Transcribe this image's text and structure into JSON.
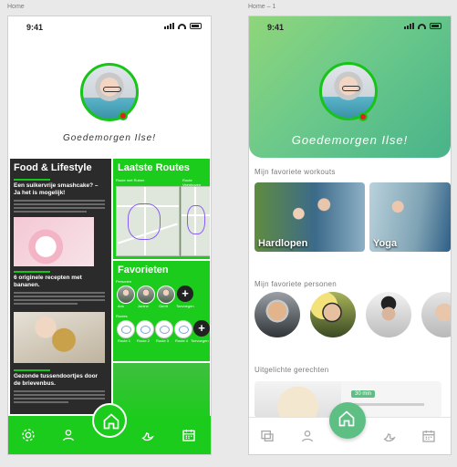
{
  "frames": {
    "left_label": "Home",
    "right_label": "Home – 1"
  },
  "status": {
    "time": "9:41"
  },
  "phone_a": {
    "greeting": "Goedemorgen Ilse!",
    "food": {
      "title": "Food & Lifestyle",
      "article1": "Een suikervrije smashcake? – Ja het is mogelijk!",
      "article2": "6 originele recepten met bananen.",
      "article3": "Gezonde tussendoortjes door de brievenbus."
    },
    "routes": {
      "title": "Laatste Routes",
      "map1_label": "Route met Ruben",
      "map2_label": "Route Veenhoven"
    },
    "favorites": {
      "title": "Favorieten",
      "persons_label": "Personen",
      "routes_label": "Routes",
      "person_names": [
        "Ans",
        "Janine",
        "Gerrit",
        "Toevoegen"
      ],
      "route_names": [
        "Route 1",
        "Route 2",
        "Route 3",
        "Route 4",
        "Toevoegen"
      ]
    },
    "nav": [
      "settings-icon",
      "profile-icon",
      "home-icon",
      "strength-icon",
      "calendar-icon"
    ]
  },
  "phone_b": {
    "greeting": "Goedemorgen Ilse!",
    "workouts_title": "Mijn favoriete workouts",
    "workouts": [
      "Hardlopen",
      "Yoga"
    ],
    "persons_title": "Mijn favoriete personen",
    "dishes_title": "Uitgelichte gerechten",
    "dish_badge": "30 min",
    "nav": [
      "photo-icon",
      "profile-icon",
      "home-icon",
      "strength-icon",
      "calendar-icon"
    ]
  },
  "colors": {
    "accent_green": "#1ccc1c",
    "soft_green": "#5dbf83",
    "status_red": "#e02020"
  }
}
